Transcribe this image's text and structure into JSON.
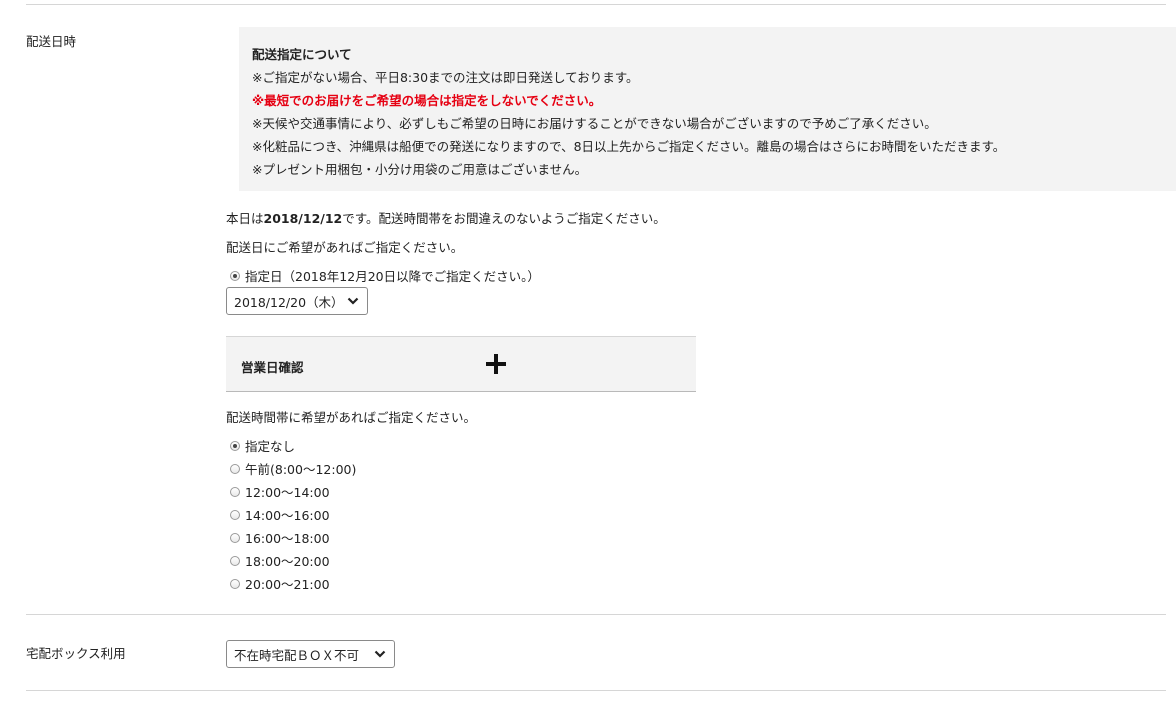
{
  "delivery": {
    "section_label": "配送日時",
    "notice": {
      "title": "配送指定について",
      "lines": [
        "※ご指定がない場合、平日8:30までの注文は即日発送しております。",
        "※最短でのお届けをご希望の場合は指定をしないでください。",
        "※天候や交通事情により、必ずしもご希望の日時にお届けすることができない場合がございますので予めご了承ください。",
        "※化粧品につき、沖縄県は船便での発送になりますので、8日以上先からご指定ください。離島の場合はさらにお時間をいただきます。",
        "※プレゼント用梱包・小分け用袋のご用意はございません。"
      ],
      "highlight_color": "#e60012"
    },
    "today_prefix": "本日は",
    "today_date": "2018/12/12",
    "today_suffix": "です。配送時間帯をお間違えのないようご指定ください。",
    "date_prompt": "配送日にご希望があればご指定ください。",
    "date_option_label": "指定日（2018年12月20日以降でご指定ください。）",
    "date_selected": "2018/12/20（木）",
    "business_day_label": "営業日確認",
    "time_prompt": "配送時間帯に希望があればご指定ください。",
    "time_options": [
      {
        "label": "指定なし",
        "checked": true
      },
      {
        "label": "午前(8:00～12:00)",
        "checked": false
      },
      {
        "label": "12:00～14:00",
        "checked": false
      },
      {
        "label": "14:00～16:00",
        "checked": false
      },
      {
        "label": "16:00～18:00",
        "checked": false
      },
      {
        "label": "18:00～20:00",
        "checked": false
      },
      {
        "label": "20:00～21:00",
        "checked": false
      }
    ]
  },
  "delivery_box": {
    "section_label": "宅配ボックス利用",
    "selected": "不在時宅配ＢＯＸ不可"
  }
}
